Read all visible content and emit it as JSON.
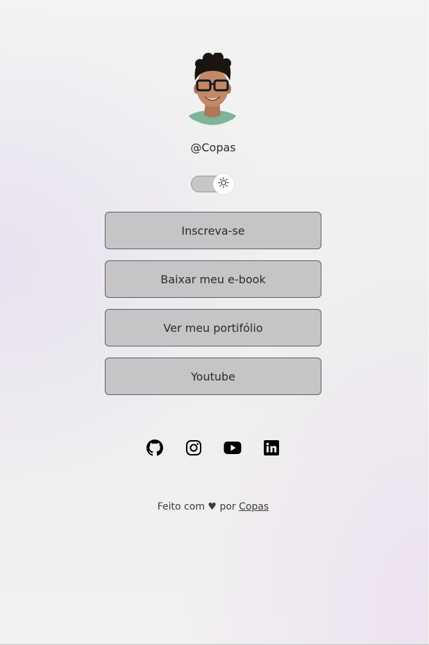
{
  "profile": {
    "handle": "@Copas"
  },
  "theme_toggle": {
    "state": "light",
    "icon": "sun-icon"
  },
  "links": [
    {
      "label": "Inscreva-se"
    },
    {
      "label": "Baixar meu e-book"
    },
    {
      "label": "Ver meu portifólio"
    },
    {
      "label": "Youtube"
    }
  ],
  "socials": [
    {
      "icon": "github-icon"
    },
    {
      "icon": "instagram-icon"
    },
    {
      "icon": "youtube-icon"
    },
    {
      "icon": "linkedin-icon"
    }
  ],
  "footer": {
    "prefix": "Feito com",
    "heart": "♥",
    "by": "por",
    "author_link": "Copas"
  },
  "colors": {
    "button_bg": "#c7c4c7",
    "button_border": "#5f5d5f",
    "icon": "#000000"
  }
}
